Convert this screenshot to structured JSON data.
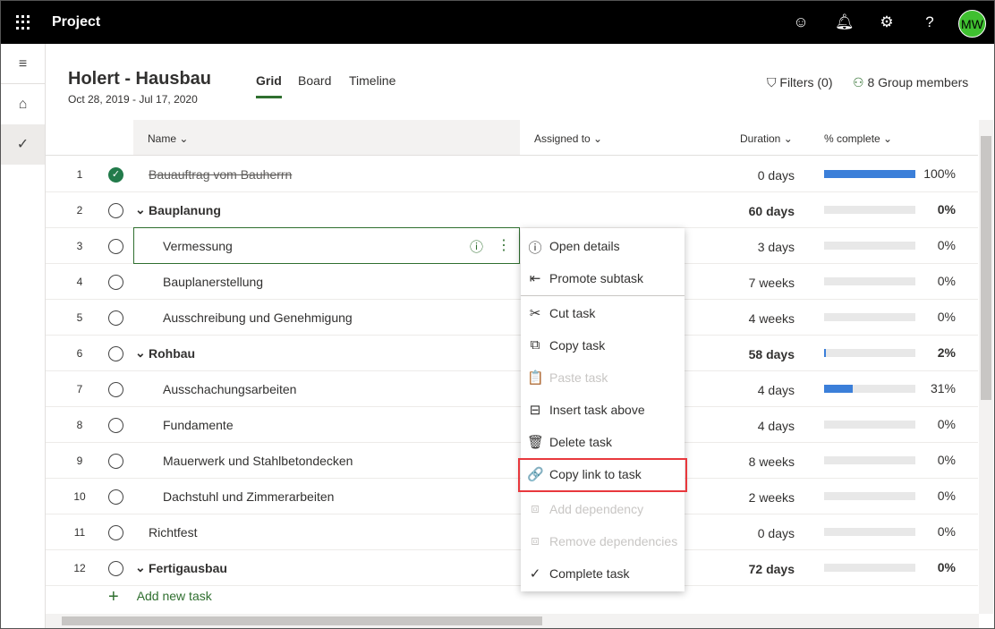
{
  "topbar": {
    "app": "Project",
    "avatar": "MW",
    "icons": [
      "waffle-icon",
      "smiley-icon",
      "bell-icon",
      "gear-icon",
      "help-icon"
    ]
  },
  "header": {
    "title": "Holert - Hausbau",
    "dates": "Oct 28, 2019 - Jul 17, 2020",
    "tabs": [
      "Grid",
      "Board",
      "Timeline"
    ],
    "active_tab": "Grid",
    "filters": "Filters (0)",
    "members": "8 Group members"
  },
  "columns": {
    "name": "Name",
    "assigned": "Assigned to",
    "duration": "Duration",
    "complete": "% complete"
  },
  "rows": [
    {
      "num": "1",
      "name": "Bauauftrag vom Bauherrn",
      "duration": "0 days",
      "pct": "100%",
      "value": 100,
      "done": true,
      "level": 0,
      "summary": false
    },
    {
      "num": "2",
      "name": "Bauplanung",
      "duration": "60 days",
      "pct": "0%",
      "value": 0,
      "level": 0,
      "summary": true
    },
    {
      "num": "3",
      "name": "Vermessung",
      "duration": "3 days",
      "pct": "0%",
      "value": 0,
      "level": 1
    },
    {
      "num": "4",
      "name": "Bauplanerstellung",
      "duration": "7 weeks",
      "pct": "0%",
      "value": 0,
      "level": 1
    },
    {
      "num": "5",
      "name": "Ausschreibung und Genehmigung",
      "duration": "4 weeks",
      "pct": "0%",
      "value": 0,
      "level": 1
    },
    {
      "num": "6",
      "name": "Rohbau",
      "duration": "58 days",
      "pct": "2%",
      "value": 2,
      "level": 0,
      "summary": true
    },
    {
      "num": "7",
      "name": "Ausschachungsarbeiten",
      "duration": "4 days",
      "pct": "31%",
      "value": 31,
      "level": 1
    },
    {
      "num": "8",
      "name": "Fundamente",
      "duration": "4 days",
      "pct": "0%",
      "value": 0,
      "level": 1
    },
    {
      "num": "9",
      "name": "Mauerwerk und Stahlbetondecken",
      "duration": "8 weeks",
      "pct": "0%",
      "value": 0,
      "level": 1
    },
    {
      "num": "10",
      "name": "Dachstuhl und Zimmerarbeiten",
      "duration": "2 weeks",
      "pct": "0%",
      "value": 0,
      "level": 1
    },
    {
      "num": "11",
      "name": "Richtfest",
      "duration": "0 days",
      "pct": "0%",
      "value": 0,
      "level": 0
    },
    {
      "num": "12",
      "name": "Fertigausbau",
      "duration": "72 days",
      "pct": "0%",
      "value": 0,
      "level": 0,
      "summary": true
    }
  ],
  "add_task": "Add new task",
  "menu": [
    {
      "label": "Open details",
      "icon": "info-icon",
      "glyph": "ⓘ",
      "disabled": false
    },
    {
      "label": "Promote subtask",
      "icon": "promote-icon",
      "glyph": "⇤",
      "disabled": false
    },
    {
      "label": "Cut task",
      "icon": "scissors-icon",
      "glyph": "✂",
      "disabled": false
    },
    {
      "label": "Copy task",
      "icon": "copy-icon",
      "glyph": "⧉",
      "disabled": false
    },
    {
      "label": "Paste task",
      "icon": "paste-icon",
      "glyph": "📋",
      "disabled": true
    },
    {
      "label": "Insert task above",
      "icon": "insert-above-icon",
      "glyph": "⊟",
      "disabled": false
    },
    {
      "label": "Delete task",
      "icon": "trash-icon",
      "glyph": "🗑",
      "disabled": false
    },
    {
      "label": "Copy link to task",
      "icon": "link-icon",
      "glyph": "🔗",
      "disabled": false,
      "highlighted": true
    },
    {
      "label": "Add dependency",
      "icon": "add-dependency-icon",
      "glyph": "⧈",
      "disabled": true
    },
    {
      "label": "Remove dependencies",
      "icon": "remove-dependency-icon",
      "glyph": "⧈",
      "disabled": true
    },
    {
      "label": "Complete task",
      "icon": "check-circle-icon",
      "glyph": "✓",
      "disabled": false
    }
  ],
  "colors": {
    "accent": "#2f6f2f",
    "progress": "#3b7fd9",
    "highlight": "#e8383d"
  }
}
